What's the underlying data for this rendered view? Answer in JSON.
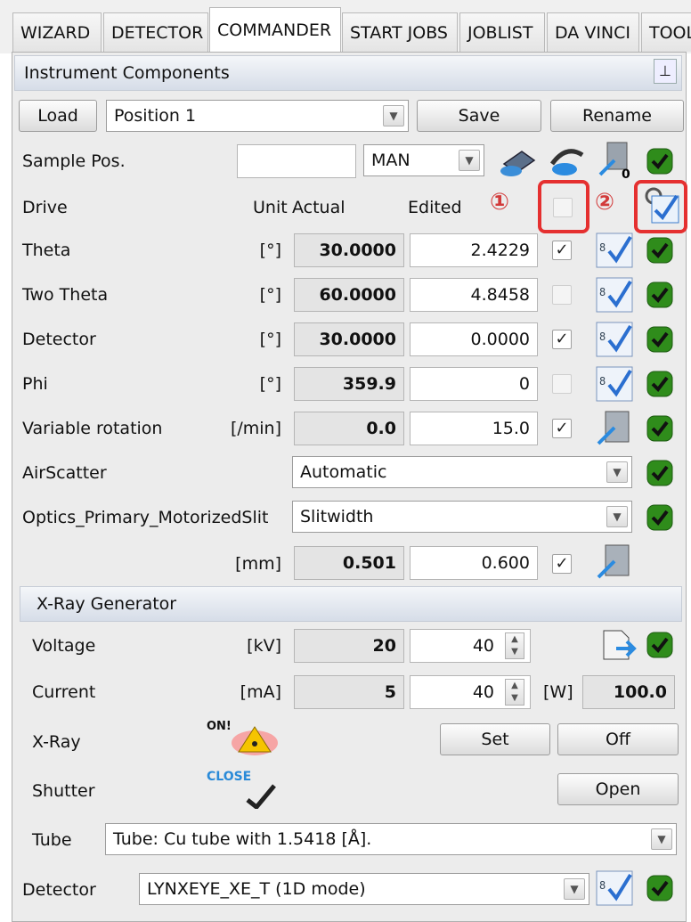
{
  "tabs": [
    "WIZARD",
    "DETECTOR",
    "COMMANDER",
    "START JOBS",
    "JOBLIST",
    "DA VINCI",
    "TOOL"
  ],
  "panel": {
    "title": "Instrument Components",
    "pin_icon": "pin-icon"
  },
  "toolbar": {
    "load": "Load",
    "position": "Position 1",
    "save": "Save",
    "rename": "Rename"
  },
  "sample": {
    "label": "Sample Pos.",
    "value": "",
    "mode": "MAN"
  },
  "drive": {
    "label": "Drive",
    "unit_header": "Unit",
    "actual_header": "Actual",
    "edited_header": "Edited",
    "marker1": "①",
    "marker2": "②"
  },
  "axes": [
    {
      "name": "Theta",
      "unit": "[°]",
      "actual": "30.0000",
      "edited": "2.4229",
      "checked": true,
      "check": "✓"
    },
    {
      "name": "Two Theta",
      "unit": "[°]",
      "actual": "60.0000",
      "edited": "4.8458",
      "checked": false,
      "check": ""
    },
    {
      "name": "Detector",
      "unit": "[°]",
      "actual": "30.0000",
      "edited": "0.0000",
      "checked": true,
      "check": "✓"
    },
    {
      "name": "Phi",
      "unit": "[°]",
      "actual": "359.9",
      "edited": "0",
      "checked": false,
      "check": ""
    },
    {
      "name": "Variable rotation",
      "unit": "[/min]",
      "actual": "0.0",
      "edited": "15.0",
      "checked": true,
      "check": "✓"
    }
  ],
  "airscatter": {
    "label": "AirScatter",
    "value": "Automatic"
  },
  "optics": {
    "label": "Optics_Primary_MotorizedSlit",
    "value": "Slitwidth",
    "unit": "[mm]",
    "actual": "0.501",
    "edited": "0.600",
    "check": "✓"
  },
  "xray": {
    "title": "X-Ray Generator",
    "voltage": {
      "label": "Voltage",
      "unit": "[kV]",
      "actual": "20",
      "edited": "40"
    },
    "current": {
      "label": "Current",
      "unit": "[mA]",
      "actual": "5",
      "edited": "40",
      "power_unit": "[W]",
      "power": "100.0"
    },
    "xray_label": "X-Ray",
    "xray_state": "ON!",
    "set": "Set",
    "off": "Off",
    "shutter_label": "Shutter",
    "shutter_state": "CLOSE",
    "open": "Open",
    "tube_label": "Tube",
    "tube": "Tube: Cu tube with 1.5418 [Å]."
  },
  "detector": {
    "label": "Detector",
    "value": "LYNXEYE_XE_T (1D mode)"
  },
  "colors": {
    "ok_green": "#2f8c1b",
    "highlight_red": "#e53030",
    "header_blue": "#d6dde8"
  }
}
